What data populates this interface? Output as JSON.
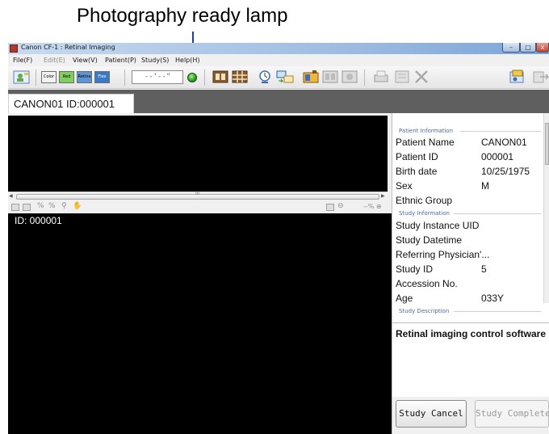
{
  "annotation": {
    "callout": "Photography ready lamp"
  },
  "window": {
    "title": "Canon CF-1 : Retinal Imaging",
    "controls": {
      "minimize": "–",
      "maximize": "□",
      "close": "x"
    }
  },
  "menu": [
    "File(F)",
    "Edit(E)",
    "View(V)",
    "Patient(P)",
    "Study(S)",
    "Help(H)"
  ],
  "toolbar": {
    "modes": [
      "Color",
      "Red Free",
      "Retina",
      "Flex"
    ],
    "time_display": "--'--\"",
    "lamp_status": "ready"
  },
  "tab": {
    "label": "CANON01 ID:000001"
  },
  "viewer": {
    "study_label": "ID: 000001",
    "scroll_grip": "III",
    "zoom_label": "--% ⊕"
  },
  "patient_info": {
    "header": "Patient Information",
    "rows": [
      {
        "label": "Patient Name",
        "value": "CANON01"
      },
      {
        "label": "Patient ID",
        "value": "000001"
      },
      {
        "label": "Birth date",
        "value": "10/25/1975"
      },
      {
        "label": "Sex",
        "value": "M"
      },
      {
        "label": "Ethnic Group",
        "value": ""
      }
    ]
  },
  "study_info": {
    "header": "Study Information",
    "rows": [
      {
        "label": "Study Instance UID",
        "value": ""
      },
      {
        "label": "Study Datetime",
        "value": ""
      },
      {
        "label": "Referring Physician'...",
        "value": ""
      },
      {
        "label": "Study ID",
        "value": "5"
      },
      {
        "label": "Accession No.",
        "value": ""
      },
      {
        "label": "Age",
        "value": "033Y"
      }
    ]
  },
  "study_description": {
    "header": "Study Description",
    "text": "Retinal imaging control software"
  },
  "buttons": {
    "study_cancel": "Study Cancel",
    "study_complete": "Study Complete"
  },
  "colors": {
    "lamp": "#2f9a22",
    "callout_line": "#1b3fb3",
    "tab_strip": "#5f5f5f",
    "group_header": "#4a6aa8"
  },
  "icons": [
    "app-icon",
    "patient-icon",
    "time-icon",
    "film-icon",
    "grid-icon",
    "clock-icon",
    "transfer-icon",
    "camera-icon",
    "print-icon",
    "delete-icon",
    "exit-icon"
  ]
}
